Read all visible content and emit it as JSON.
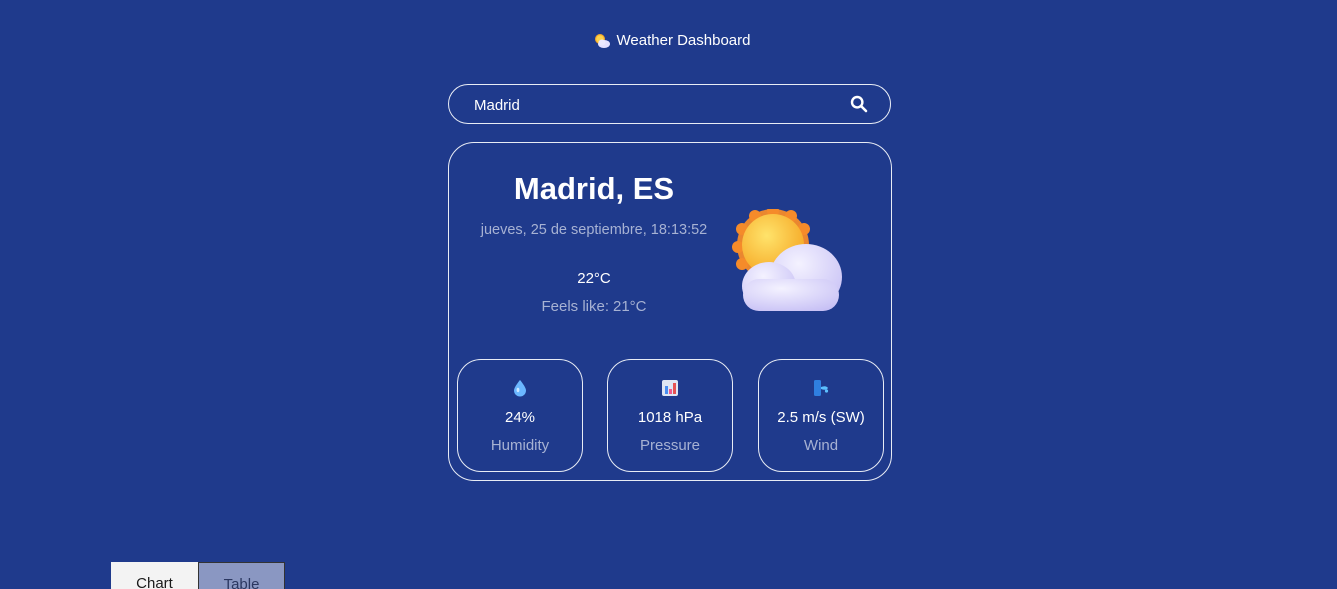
{
  "header": {
    "title": "Weather Dashboard",
    "icon": "sun-behind-cloud-icon"
  },
  "search": {
    "value": "Madrid",
    "button_icon": "search-icon"
  },
  "current": {
    "city": "Madrid, ES",
    "datetime": "jueves, 25 de septiembre, 18:13:52",
    "temperature": "22°C",
    "feels_like_label": "Feels like:",
    "feels_like_value": "21°C",
    "condition_icon": "sun-behind-cloud-icon"
  },
  "stats": [
    {
      "icon": "droplet-icon",
      "value": "24%",
      "label": "Humidity"
    },
    {
      "icon": "bar-chart-icon",
      "value": "1018 hPa",
      "label": "Pressure"
    },
    {
      "icon": "wind-icon",
      "value": "2.5 m/s (SW)",
      "label": "Wind"
    }
  ],
  "tabs": [
    {
      "label": "Chart",
      "active": true
    },
    {
      "label": "Table",
      "active": false
    }
  ],
  "colors": {
    "background": "#1f3a8c",
    "border": "#e8ecf5",
    "muted_text": "#a7b2d3",
    "sun": "#f7b928",
    "cloud": "#d7d3fb"
  }
}
